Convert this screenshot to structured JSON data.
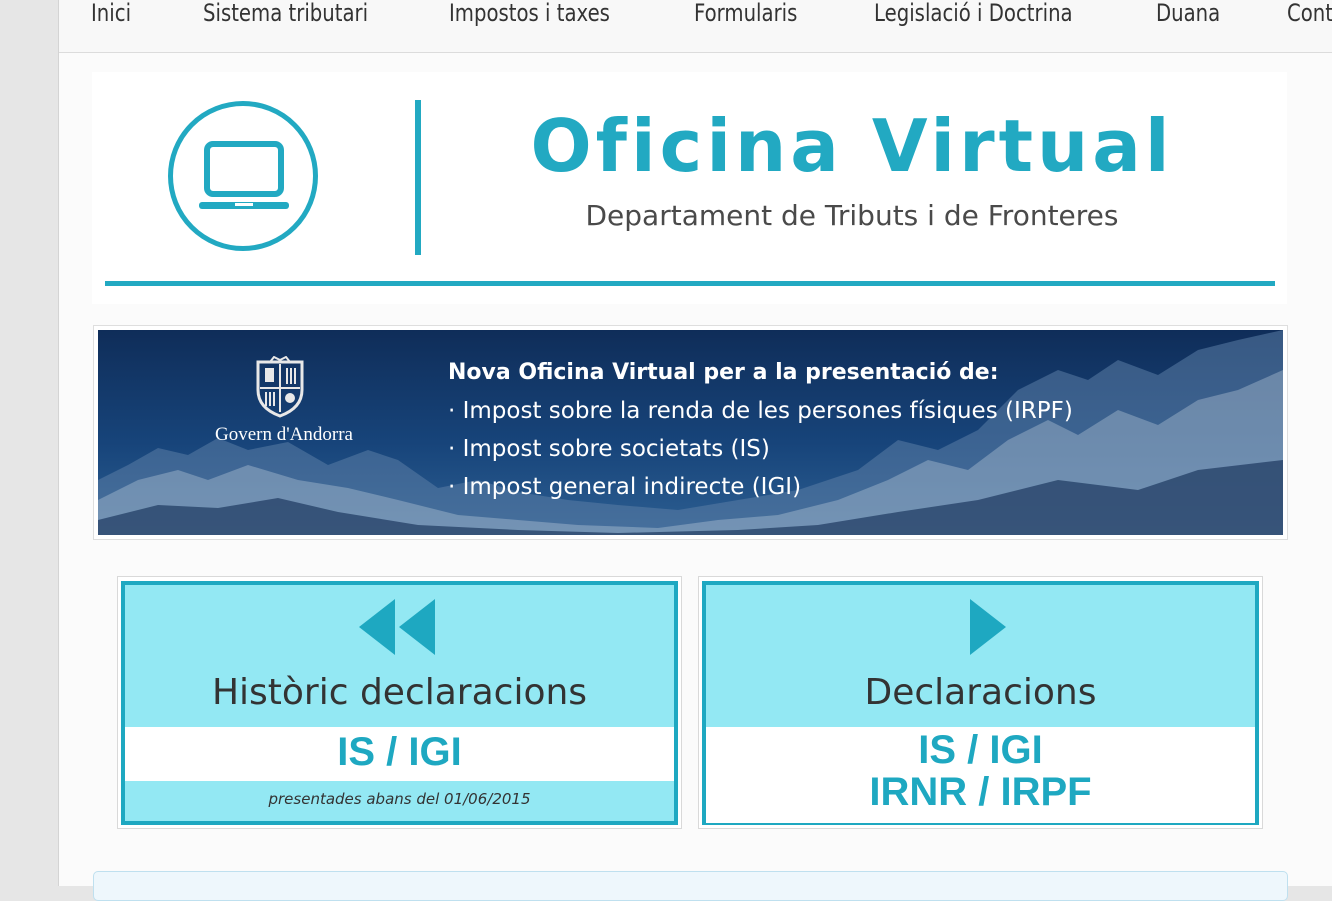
{
  "nav": {
    "items": [
      {
        "label": "Inici"
      },
      {
        "label": "Sistema tributari"
      },
      {
        "label": "Impostos i taxes"
      },
      {
        "label": "Formularis"
      },
      {
        "label": "Legislació i Doctrina"
      },
      {
        "label": "Duana"
      },
      {
        "label": "Cont"
      }
    ]
  },
  "header": {
    "title": "Oficina Virtual",
    "subtitle": "Departament de Tributs i de Fronteres",
    "icon": "laptop-icon",
    "accent_color": "#22a9c2"
  },
  "banner": {
    "org": "Govern d'Andorra",
    "heading": "Nova Oficina Virtual per a la presentació de:",
    "items": [
      "· Impost sobre la renda de les persones físiques (IRPF)",
      "· Impost sobre societats (IS)",
      "· Impost general indirecte (IGI)"
    ]
  },
  "tiles": {
    "historic": {
      "title": "Històric declaracions",
      "code": "IS / IGI",
      "note": "presentades abans del 01/06/2015",
      "icon": "rewind-icon"
    },
    "current": {
      "title": "Declaracions",
      "code_line1": "IS / IGI",
      "code_line2": "IRNR / IRPF",
      "icon": "play-icon"
    }
  },
  "colors": {
    "tile_bg": "#93e8f3",
    "tile_border": "#1ea8c1",
    "banner_bg": "#17447a"
  }
}
